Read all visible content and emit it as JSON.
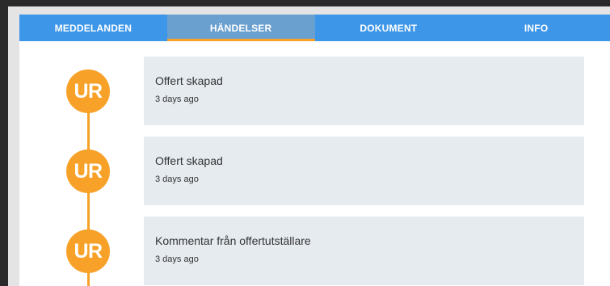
{
  "tabs": [
    {
      "label": "MEDDELANDEN",
      "active": false
    },
    {
      "label": "HÄNDELSER",
      "active": true
    },
    {
      "label": "DOKUMENT",
      "active": false
    },
    {
      "label": "INFO",
      "active": false
    }
  ],
  "events": [
    {
      "avatar": "UR",
      "title": "Offert skapad",
      "time": "3 days ago"
    },
    {
      "avatar": "UR",
      "title": "Offert skapad",
      "time": "3 days ago"
    },
    {
      "avatar": "UR",
      "title": "Kommentar från offertutställare",
      "time": "3 days ago"
    }
  ],
  "colors": {
    "tab_bar": "#3d96e8",
    "active_tab": "#6aa0d0",
    "accent": "#f7a128",
    "card_bg": "#e6ebf0"
  }
}
